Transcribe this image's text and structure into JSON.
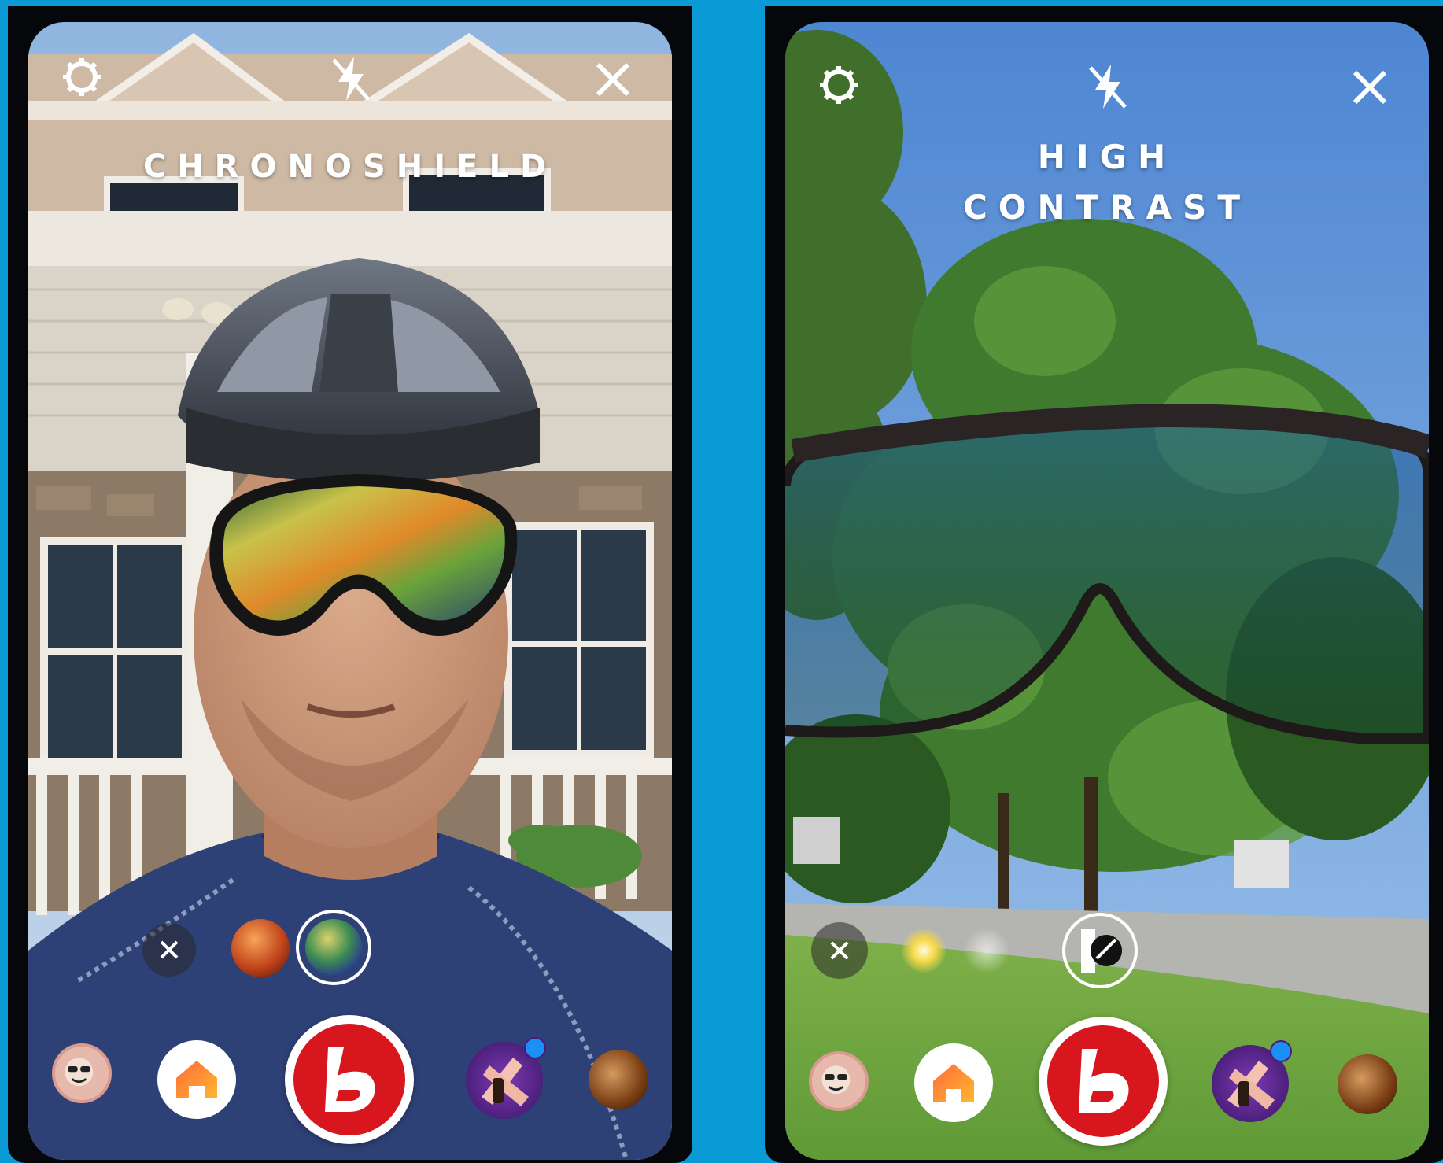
{
  "screens": [
    {
      "id": "left",
      "title_lines": [
        "CHRONOSHIELD"
      ]
    },
    {
      "id": "right",
      "title_lines": [
        "HIGH",
        "CONTRAST"
      ]
    }
  ],
  "icons": {
    "settings": "gear-icon",
    "flash": "flash-off-icon",
    "close": "close-icon",
    "remove_filter": "close-icon",
    "profile": "avatar",
    "home": "home-icon",
    "capture": "bolle-logo-icon"
  },
  "colors": {
    "frame_background": "#0a9ad6",
    "capture_red": "#d7161e",
    "notification_blue": "#1a90f5",
    "title_text": "#ffffff"
  }
}
